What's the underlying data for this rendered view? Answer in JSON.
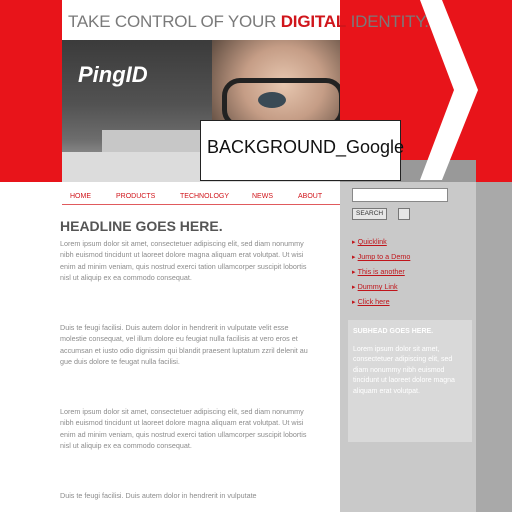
{
  "header": {
    "tagline_pre": "TAKE CONTROL OF YOUR ",
    "tagline_hl": "DIGITAL",
    "tagline_post": " IDENTITY."
  },
  "banner": {
    "logo": "PingID"
  },
  "nav": {
    "items": [
      "HOME",
      "PRODUCTS",
      "TECHNOLOGY",
      "NEWS",
      "ABOUT"
    ]
  },
  "main": {
    "headline": "HEADLINE GOES HERE.",
    "paragraphs": [
      "Lorem ipsum dolor sit amet, consectetuer adipiscing elit, sed diam nonummy nibh euismod tincidunt ut laoreet dolore magna aliquam erat volutpat. Ut wisi enim ad minim veniam, quis nostrud exerci tation ullamcorper suscipit lobortis nisl ut aliquip ex ea commodo consequat.",
      "Duis te feugi facilisi. Duis autem dolor in hendrerit in vulputate velit esse molestie consequat, vel illum dolore eu feugiat nulla facilisis at vero eros et accumsan et iusto odio dignissim qui blandit praesent luptatum zzril delenit au gue duis dolore te feugat nulla facilisi.",
      "Lorem ipsum dolor sit amet, consectetuer adipiscing elit, sed diam nonummy nibh euismod tincidunt ut laoreet dolore magna aliquam erat volutpat. Ut wisi enim ad minim veniam, quis nostrud exerci tation ullamcorper suscipit lobortis nisl ut aliquip ex ea commodo consequat.",
      "Duis te feugi facilisi. Duis autem dolor in hendrerit in vulputate"
    ]
  },
  "sidebar": {
    "search_button": "SEARCH",
    "links": [
      "Quicklink",
      "Jump to a Demo",
      "This is another",
      "Dummy Link",
      "Click here"
    ],
    "subhead": "SUBHEAD GOES HERE.",
    "paragraph": "Lorem ipsum dolor sit amet, consectetuer adipiscing elit, sed diam nonummy nibh euismod tincidunt ut laoreet dolore magna aliquam erat volutpat."
  },
  "overlay": {
    "label": "BACKGROUND_Google"
  },
  "colors": {
    "brand_red": "#e8141a",
    "sidebar_gray": "#c9c9c9"
  }
}
